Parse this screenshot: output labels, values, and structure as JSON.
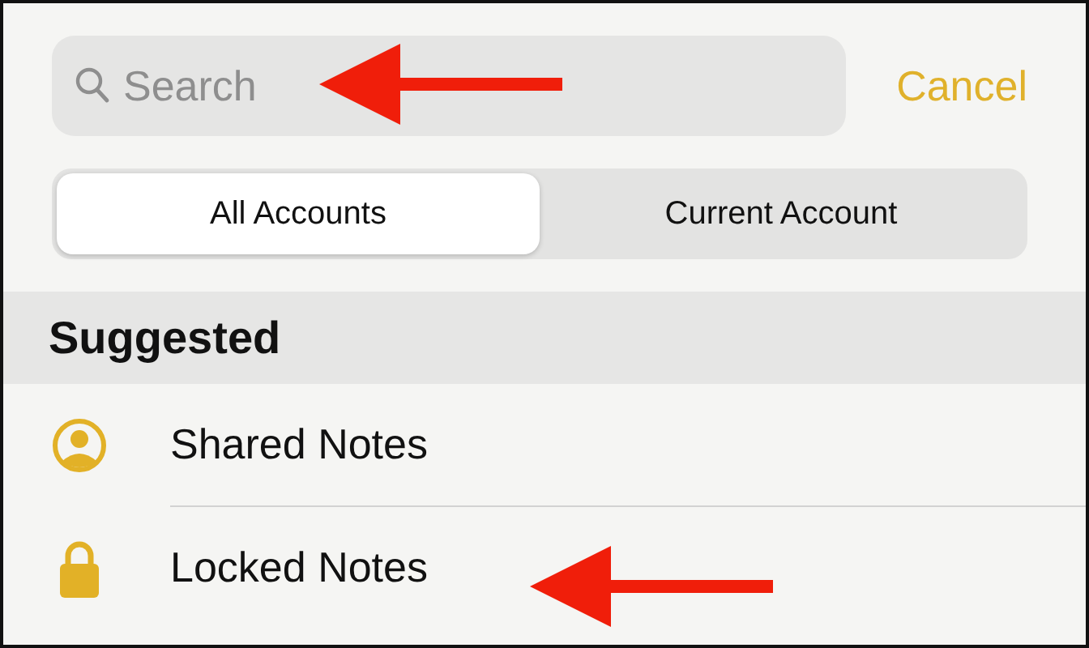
{
  "search": {
    "placeholder": "Search",
    "cancel": "Cancel"
  },
  "segments": [
    {
      "label": "All Accounts",
      "selected": true
    },
    {
      "label": "Current Account",
      "selected": false
    }
  ],
  "section": {
    "title": "Suggested",
    "items": [
      {
        "label": "Shared Notes",
        "kind": "shared"
      },
      {
        "label": "Locked Notes",
        "kind": "locked"
      }
    ]
  }
}
